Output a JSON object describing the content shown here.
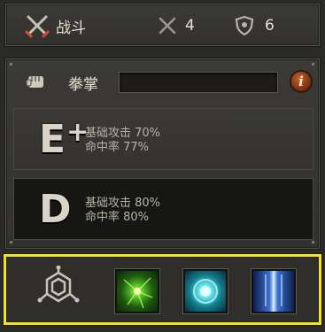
{
  "topbar": {
    "category_label": "战斗",
    "weapon_count": "4",
    "defense_count": "6"
  },
  "skill": {
    "name": "拳掌",
    "grades": [
      {
        "grade": "E",
        "modifier": "+",
        "attack": "基础攻击 70%",
        "accuracy": "命中率 77%"
      },
      {
        "grade": "D",
        "modifier": "",
        "attack": "基础攻击 80%",
        "accuracy": "命中率 80%"
      }
    ]
  },
  "icons": {
    "topbar": [
      "crossed-swords-icon",
      "crossed-blades-icon",
      "shield-icon"
    ],
    "skill": [
      "fist-icon",
      "info-icon"
    ],
    "slots": [
      "hexagon-emblem-icon",
      "green-energy-skill",
      "cyan-orb-skill",
      "blue-light-skill"
    ]
  },
  "colors": {
    "highlight_border": "#f2e61a",
    "info_button": "#b0521f"
  }
}
